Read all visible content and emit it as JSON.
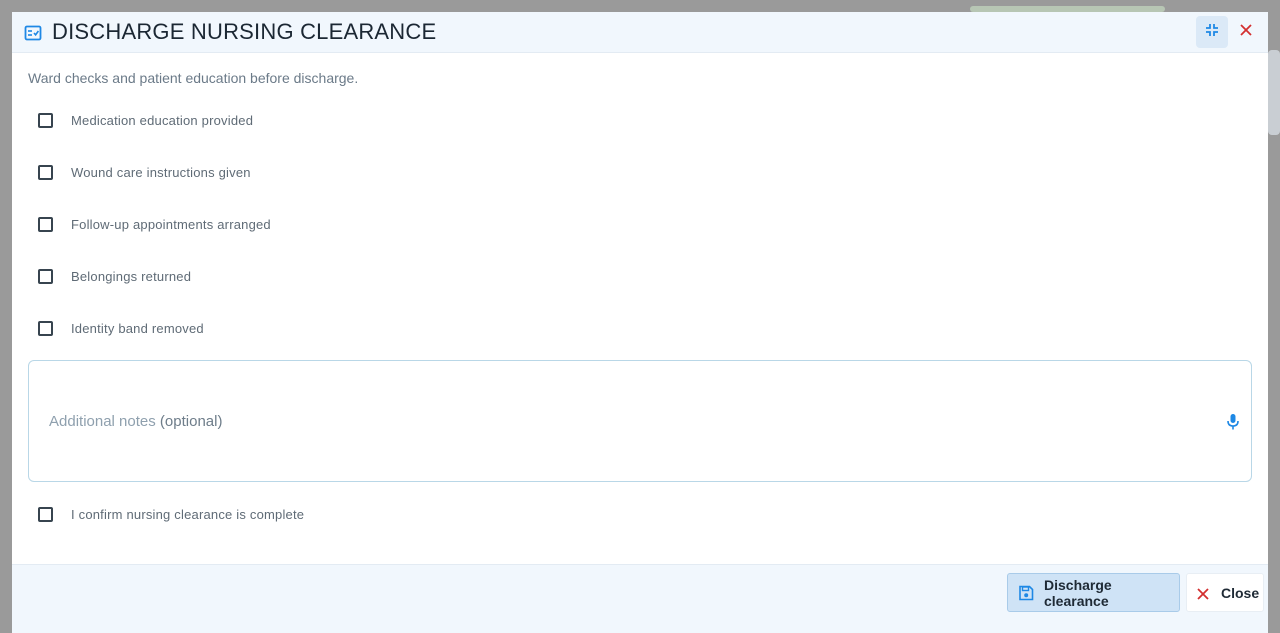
{
  "modal": {
    "title": "DISCHARGE NURSING CLEARANCE",
    "subtitle": "Ward checks and patient education before discharge.",
    "checklist": [
      {
        "label": "Medication education provided",
        "checked": false
      },
      {
        "label": "Wound care instructions given",
        "checked": false
      },
      {
        "label": "Follow-up appointments arranged",
        "checked": false
      },
      {
        "label": "Belongings returned",
        "checked": false
      },
      {
        "label": "Identity band removed",
        "checked": false
      }
    ],
    "notes": {
      "label": "Additional notes",
      "optional_text": "(optional)",
      "value": ""
    },
    "confirm": {
      "label": "I confirm nursing clearance is complete",
      "checked": false
    },
    "footer": {
      "save_label": "Discharge clearance",
      "close_label": "Close"
    }
  },
  "colors": {
    "accent": "#1e88e5",
    "danger": "#d32f2f",
    "header_bg": "#f1f7fd"
  },
  "icons": {
    "header": "checklist-icon",
    "minimize": "compress-icon",
    "close": "close-icon",
    "mic": "microphone-icon",
    "save": "floppy-disk-icon"
  }
}
